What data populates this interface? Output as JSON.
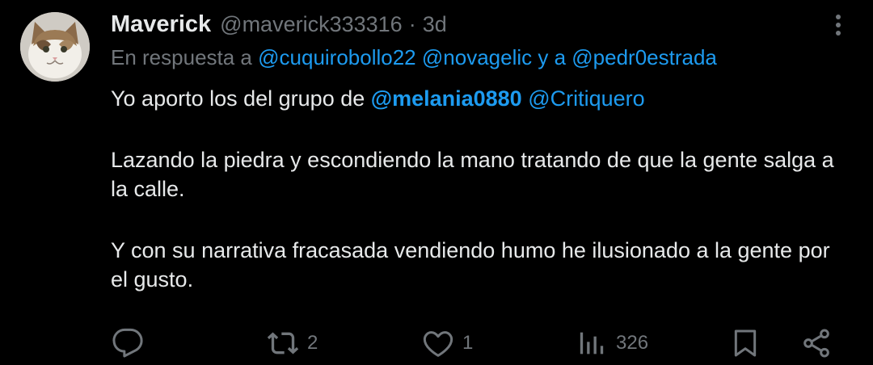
{
  "tweet": {
    "avatar_icon": "cat-avatar",
    "display_name": "Maverick",
    "handle": "@maverick333316",
    "separator": "·",
    "time": "3d",
    "more_icon": "more-vertical-icon",
    "reply_prefix": "En respuesta a ",
    "reply_to": [
      "@cuquirobollo22",
      "@novagelic",
      "@pedr0estrada"
    ],
    "reply_joiner": " y a ",
    "body": {
      "line1_text": "Yo aporto los del grupo de ",
      "line1_mention_bold": "@melania0880",
      "line1_mention": "@Critiquero",
      "para2": "Lazando la piedra y escondiendo la mano tratando de que la gente salga a la calle.",
      "para3": "Y con su narrativa fracasada vendiendo humo he ilusionado a la gente por el gusto."
    },
    "actions": {
      "reply_icon": "reply-icon",
      "retweet_icon": "retweet-icon",
      "retweet_count": "2",
      "like_icon": "heart-icon",
      "like_count": "1",
      "views_icon": "views-icon",
      "views_count": "326",
      "bookmark_icon": "bookmark-icon",
      "share_icon": "share-icon"
    }
  },
  "colors": {
    "background": "#000000",
    "text": "#e7e9ea",
    "muted": "#71767b",
    "link": "#1d9bf0"
  }
}
